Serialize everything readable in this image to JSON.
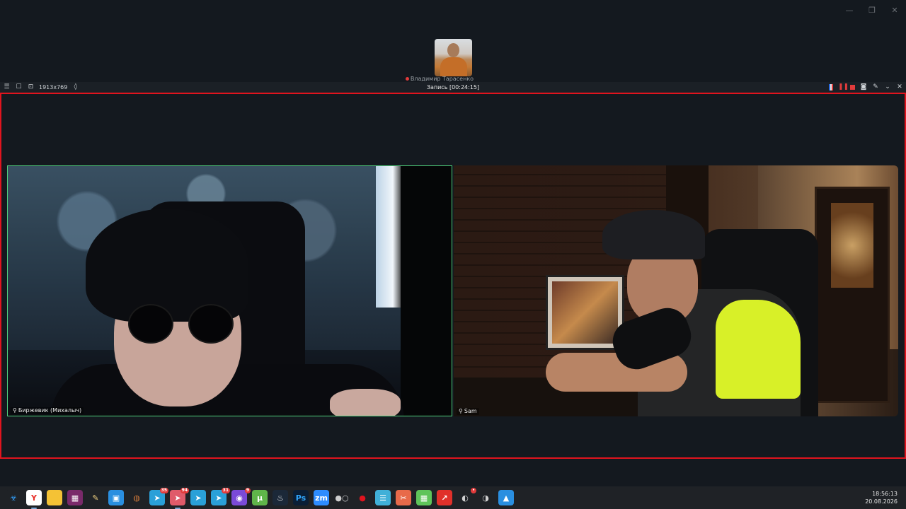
{
  "window_controls": {
    "minimize": "—",
    "maximize": "❐",
    "close": "✕"
  },
  "thumbnail": {
    "label": "Владимир Тарасенко"
  },
  "recorder": {
    "dimensions": "1913x769",
    "title": "Запись [00:24:15]",
    "icons": [
      "menu-icon",
      "region-icon",
      "zoom-icon",
      "drop-icon"
    ],
    "right_icons": [
      "flag-icon",
      "pause-icon",
      "stop-icon",
      "camera-icon",
      "pen-icon",
      "collapse-icon",
      "close-icon"
    ]
  },
  "participants": [
    {
      "name": "Биржевик (Михалыч)",
      "active_speaker": true
    },
    {
      "name": "Sam",
      "active_speaker": false
    }
  ],
  "taskbar": {
    "apps": [
      {
        "name": "biohazard",
        "glyph": "☣",
        "bg": "#1f2226",
        "color": "#34a3ff"
      },
      {
        "name": "yandex-browser",
        "glyph": "Y",
        "bg": "#ffffff",
        "color": "#e8302a",
        "active": true
      },
      {
        "name": "file-explorer",
        "glyph": "▬",
        "bg": "#f4c235",
        "color": "#f4c235"
      },
      {
        "name": "winrar",
        "glyph": "▦",
        "bg": "#7a2a6a",
        "color": "#ffffff"
      },
      {
        "name": "notepad",
        "glyph": "✎",
        "bg": "#1f2226",
        "color": "#f0d080"
      },
      {
        "name": "microsoft-store",
        "glyph": "▣",
        "bg": "#2a8fe0",
        "color": "#ffffff"
      },
      {
        "name": "network",
        "glyph": "◍",
        "bg": "#1f2226",
        "color": "#d07a3a"
      },
      {
        "name": "telegram-1",
        "glyph": "➤",
        "bg": "#2aa0d8",
        "color": "#ffffff",
        "badge": "35"
      },
      {
        "name": "telegram-2",
        "glyph": "➤",
        "bg": "#e05b6a",
        "color": "#ffffff",
        "badge": "94",
        "active": true
      },
      {
        "name": "telegram-3",
        "glyph": "➤",
        "bg": "#2aa0d8",
        "color": "#ffffff"
      },
      {
        "name": "telegram-4",
        "glyph": "➤",
        "bg": "#2aa0d8",
        "color": "#ffffff",
        "badge": "31"
      },
      {
        "name": "chromium",
        "glyph": "◉",
        "bg": "#7a4ad8",
        "color": "#ffffff",
        "badge": "9"
      },
      {
        "name": "utorrent",
        "glyph": "µ",
        "bg": "#5fb54a",
        "color": "#ffffff"
      },
      {
        "name": "steam",
        "glyph": "♨",
        "bg": "#1b2838",
        "color": "#ffffff"
      },
      {
        "name": "photoshop",
        "glyph": "Ps",
        "bg": "#0a1e36",
        "color": "#31a8ff"
      },
      {
        "name": "zoom",
        "glyph": "zm",
        "bg": "#2d8cff",
        "color": "#ffffff"
      },
      {
        "name": "obs-dots",
        "glyph": "●○",
        "bg": "#1f2226",
        "color": "#cfcfcf"
      },
      {
        "name": "recorder",
        "glyph": "●",
        "bg": "#1f2226",
        "color": "#e0141e"
      },
      {
        "name": "notes",
        "glyph": "☰",
        "bg": "#40b0d8",
        "color": "#ffffff"
      },
      {
        "name": "snip",
        "glyph": "✂",
        "bg": "#e86a4a",
        "color": "#ffffff"
      },
      {
        "name": "grid-app",
        "glyph": "▦",
        "bg": "#5fc45a",
        "color": "#ffffff"
      },
      {
        "name": "arrow-app",
        "glyph": "↗",
        "bg": "#e0302a",
        "color": "#ffffff"
      },
      {
        "name": "obs",
        "glyph": "◐",
        "bg": "#1f2226",
        "color": "#d0d0d0",
        "badge": "•"
      },
      {
        "name": "obs-2",
        "glyph": "◑",
        "bg": "#1f2226",
        "color": "#d0d0d0"
      },
      {
        "name": "photos",
        "glyph": "▲",
        "bg": "#2a8fe0",
        "color": "#ffffff"
      }
    ],
    "clock_time": "18:56:13",
    "clock_date": "20.08.2026"
  }
}
